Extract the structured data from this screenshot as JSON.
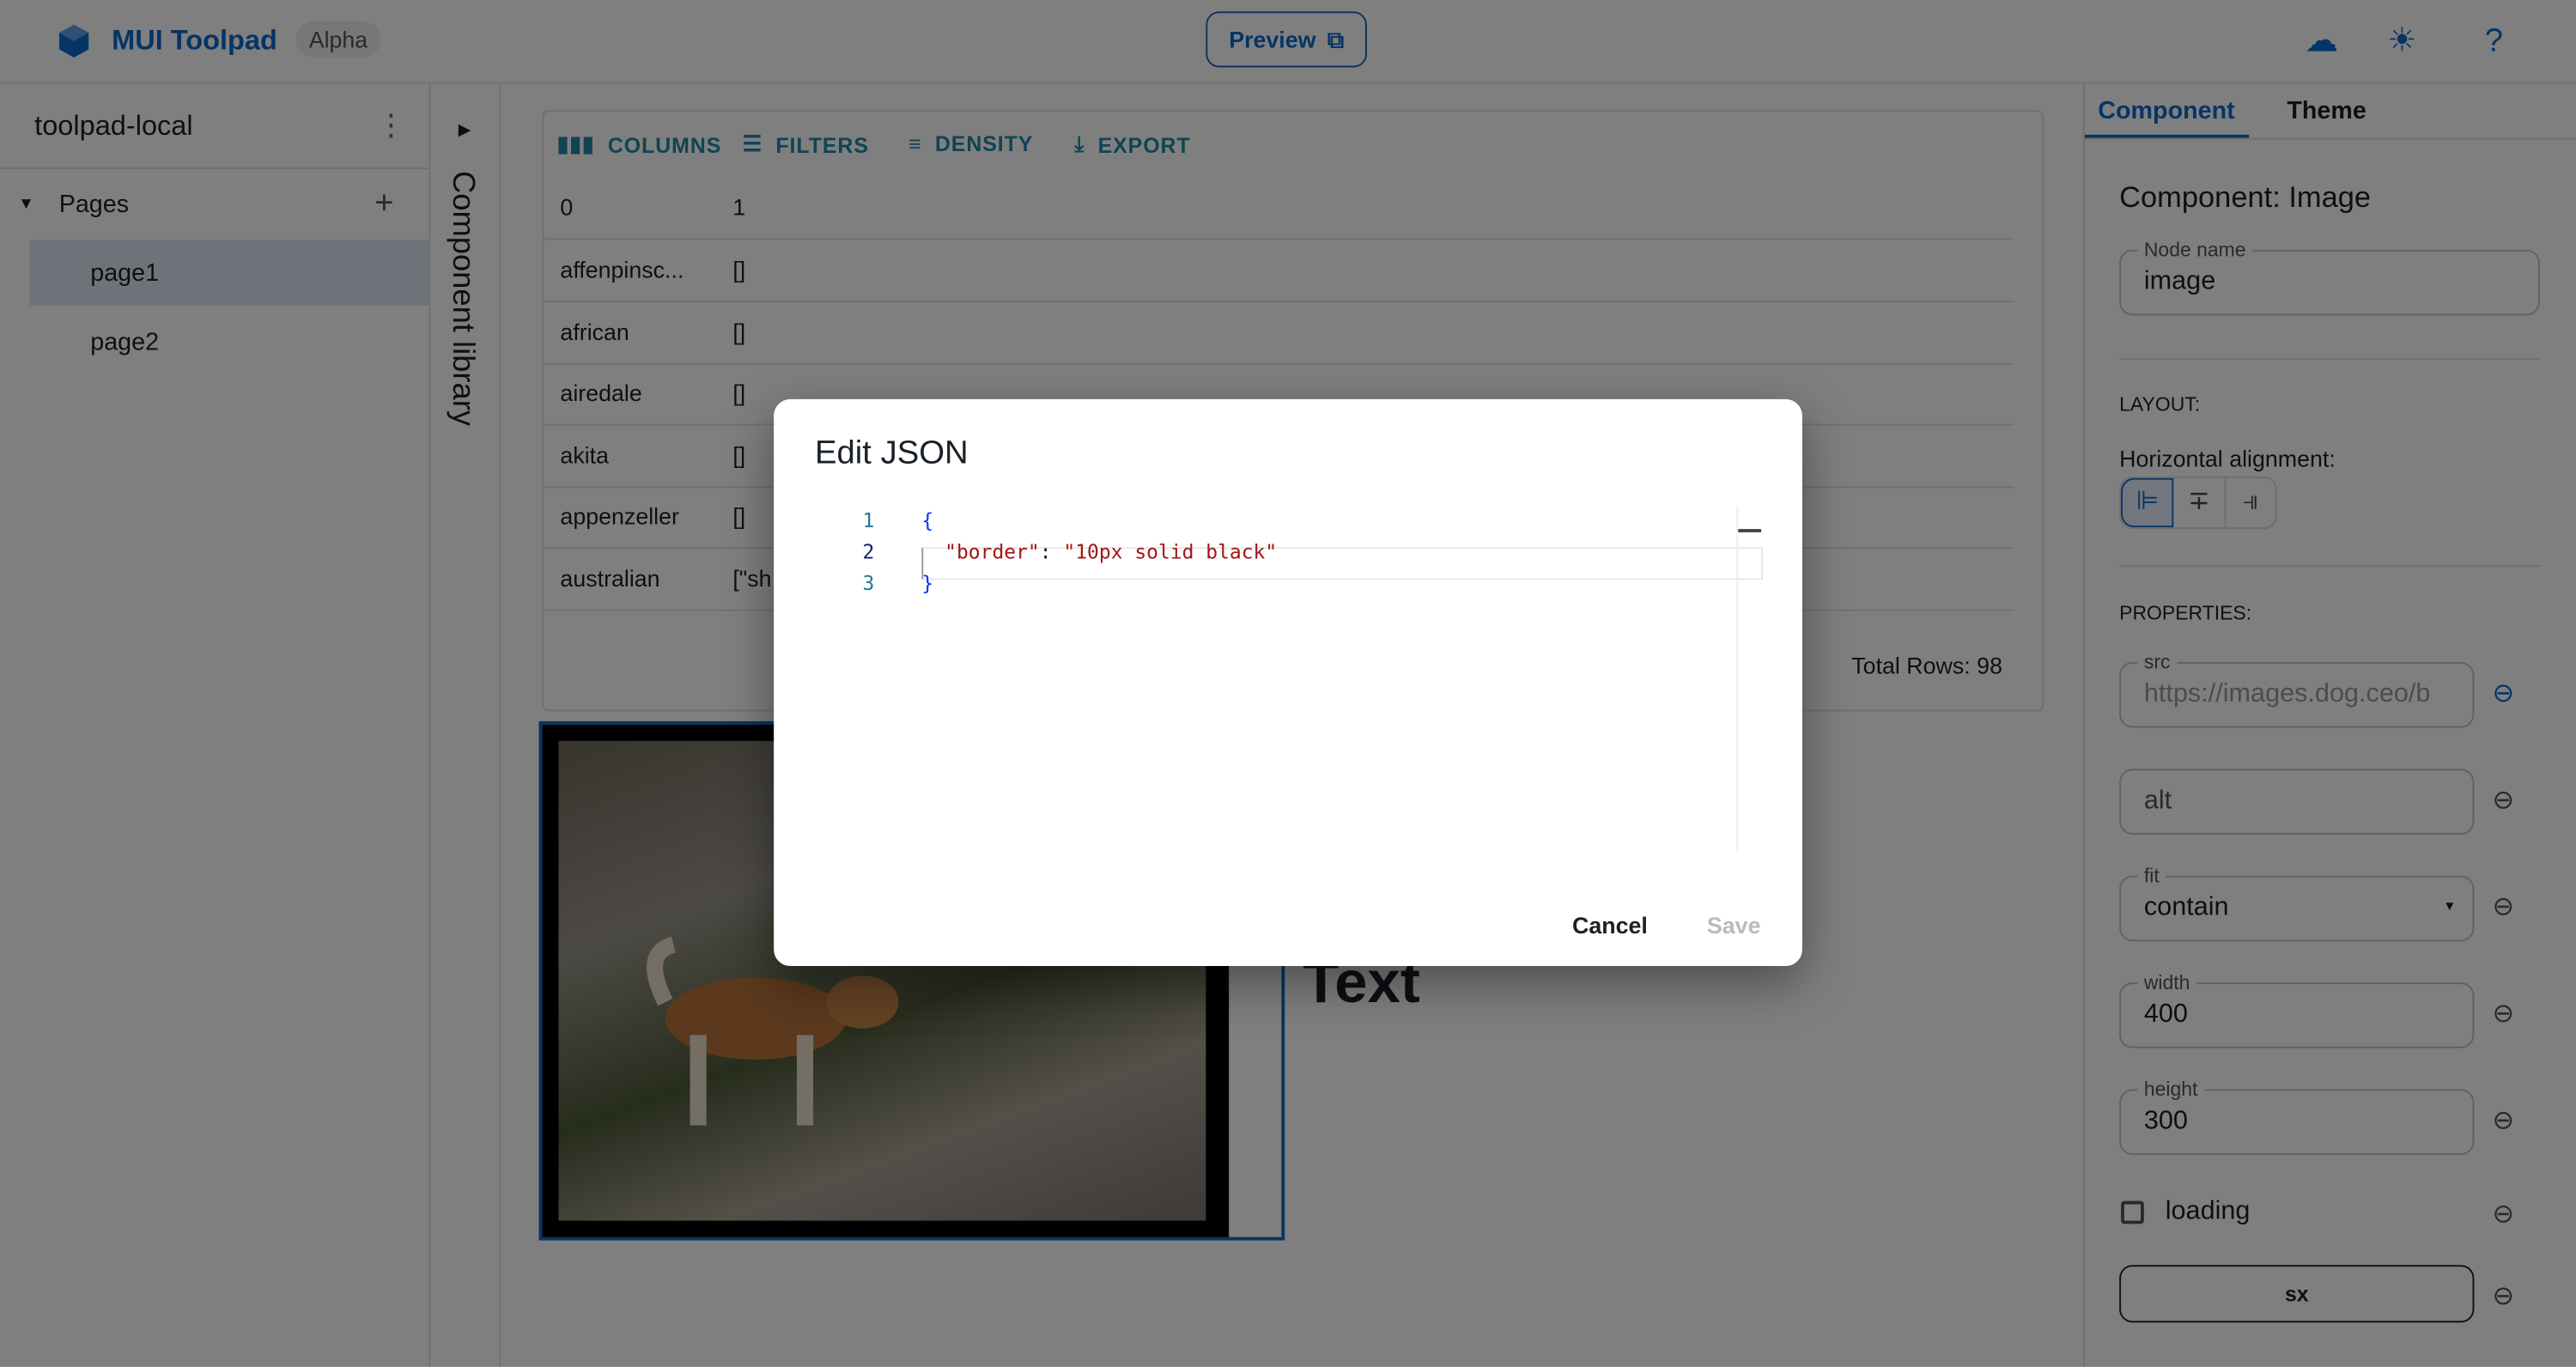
{
  "header": {
    "brand": "MUI Toolpad",
    "badge": "Alpha",
    "preview_label": "Preview",
    "icons": [
      "cloud-check-icon",
      "sun-icon",
      "help-icon"
    ]
  },
  "sidebar": {
    "project": "toolpad-local",
    "section": "Pages",
    "pages": [
      {
        "label": "page1",
        "selected": true
      },
      {
        "label": "page2",
        "selected": false
      }
    ]
  },
  "component_library": {
    "label": "Component library"
  },
  "grid": {
    "toolbar": [
      "COLUMNS",
      "FILTERS",
      "DENSITY",
      "EXPORT"
    ],
    "columns": [
      "0",
      "1"
    ],
    "rows": [
      [
        "affenpinsc...",
        "[]"
      ],
      [
        "african",
        "[]"
      ],
      [
        "airedale",
        "[]"
      ],
      [
        "akita",
        "[]"
      ],
      [
        "appenzeller",
        "[]"
      ],
      [
        "australian",
        "[\"sh"
      ]
    ],
    "total": "Total Rows: 98"
  },
  "canvas": {
    "text": "Text"
  },
  "inspector": {
    "tabs": [
      "Component",
      "Theme"
    ],
    "active_tab": "Component",
    "title": "Component: Image",
    "node_name_label": "Node name",
    "node_name": "image",
    "layout_label": "LAYOUT:",
    "halign_label": "Horizontal alignment:",
    "properties_label": "PROPERTIES:",
    "src_label": "src",
    "src_value": "https://images.dog.ceo/b",
    "alt_placeholder": "alt",
    "fit_label": "fit",
    "fit_value": "contain",
    "width_label": "width",
    "width_value": "400",
    "height_label": "height",
    "height_value": "300",
    "loading_label": "loading",
    "loading_checked": false,
    "sx_label": "sx"
  },
  "dialog": {
    "title": "Edit JSON",
    "lines": [
      {
        "n": "1",
        "text": "{"
      },
      {
        "n": "2",
        "key": "\"border\"",
        "sep": ": ",
        "value": "\"10px solid black\""
      },
      {
        "n": "3",
        "text": "}"
      }
    ],
    "cancel": "Cancel",
    "save": "Save"
  },
  "colors": {
    "primary": "#0b6bcb",
    "grid_accent": "#1e88a8",
    "json_key": "#a31515",
    "json_brace": "#0431fa"
  }
}
